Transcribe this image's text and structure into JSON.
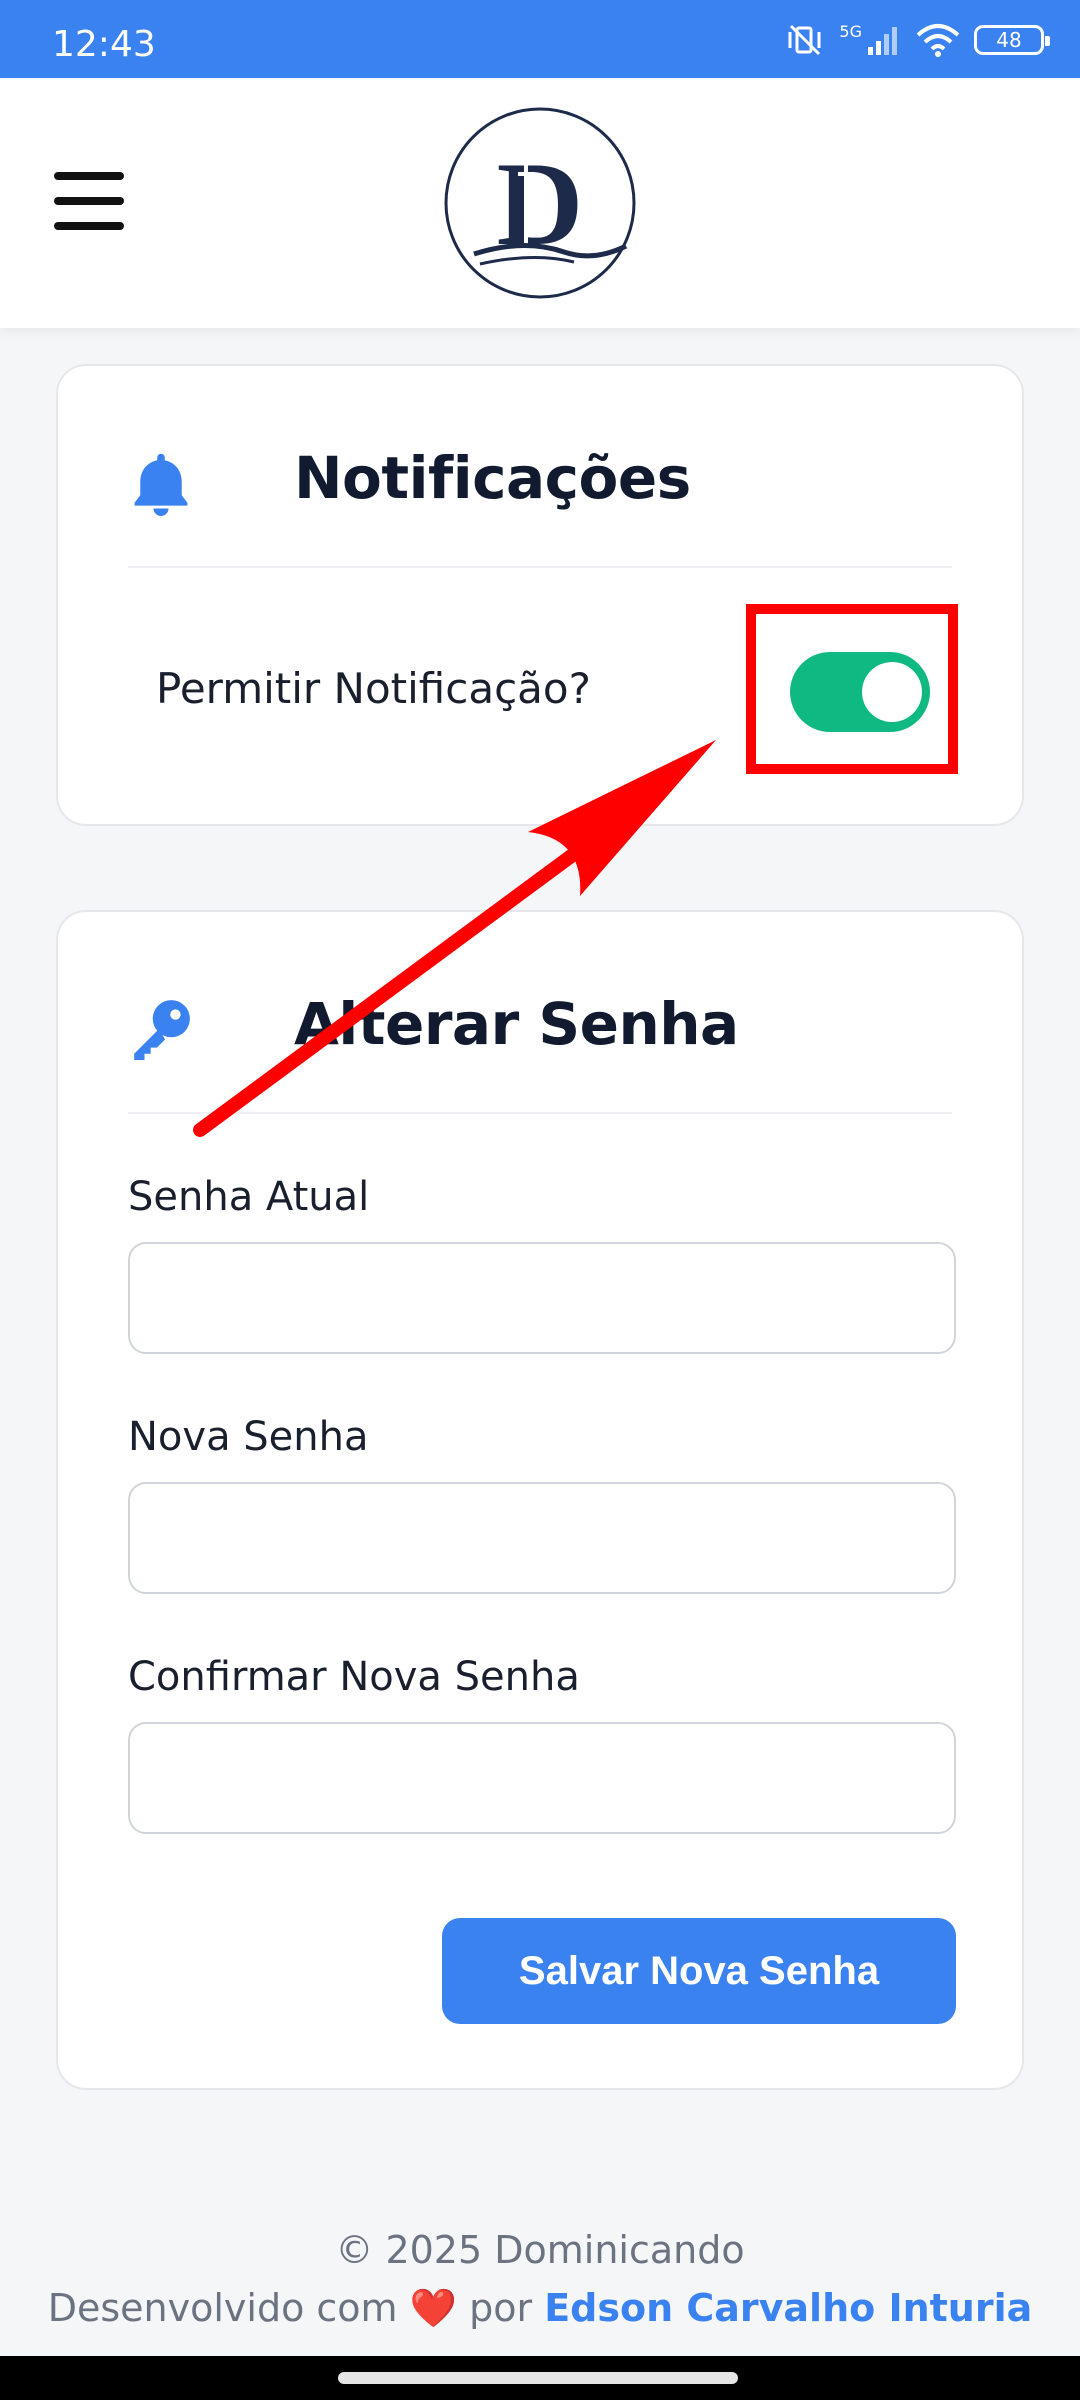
{
  "status_bar": {
    "time": "12:43",
    "network": "5G",
    "battery": "48"
  },
  "header": {
    "logo_text": "D",
    "menu_icon": "hamburger-menu-icon"
  },
  "notifications": {
    "icon": "bell-icon",
    "title": "Notificações",
    "allow_label": "Permitir Notificação?",
    "enabled": true
  },
  "change_password": {
    "icon": "key-icon",
    "title": "Alterar Senha",
    "fields": [
      {
        "label": "Senha Atual",
        "value": ""
      },
      {
        "label": "Nova Senha",
        "value": ""
      },
      {
        "label": "Confirmar Nova Senha",
        "value": ""
      }
    ],
    "save_label": "Salvar Nova Senha"
  },
  "footer": {
    "copyright": "© 2025 Dominicando",
    "developed_prefix": "Desenvolvido com",
    "heart": "❤️",
    "developed_by": "por",
    "author": "Edson Carvalho Inturia"
  },
  "colors": {
    "primary": "#3b82f1",
    "toggle_on": "#10b981",
    "annotation": "#ff0000",
    "logo_navy": "#1e2a4a"
  }
}
